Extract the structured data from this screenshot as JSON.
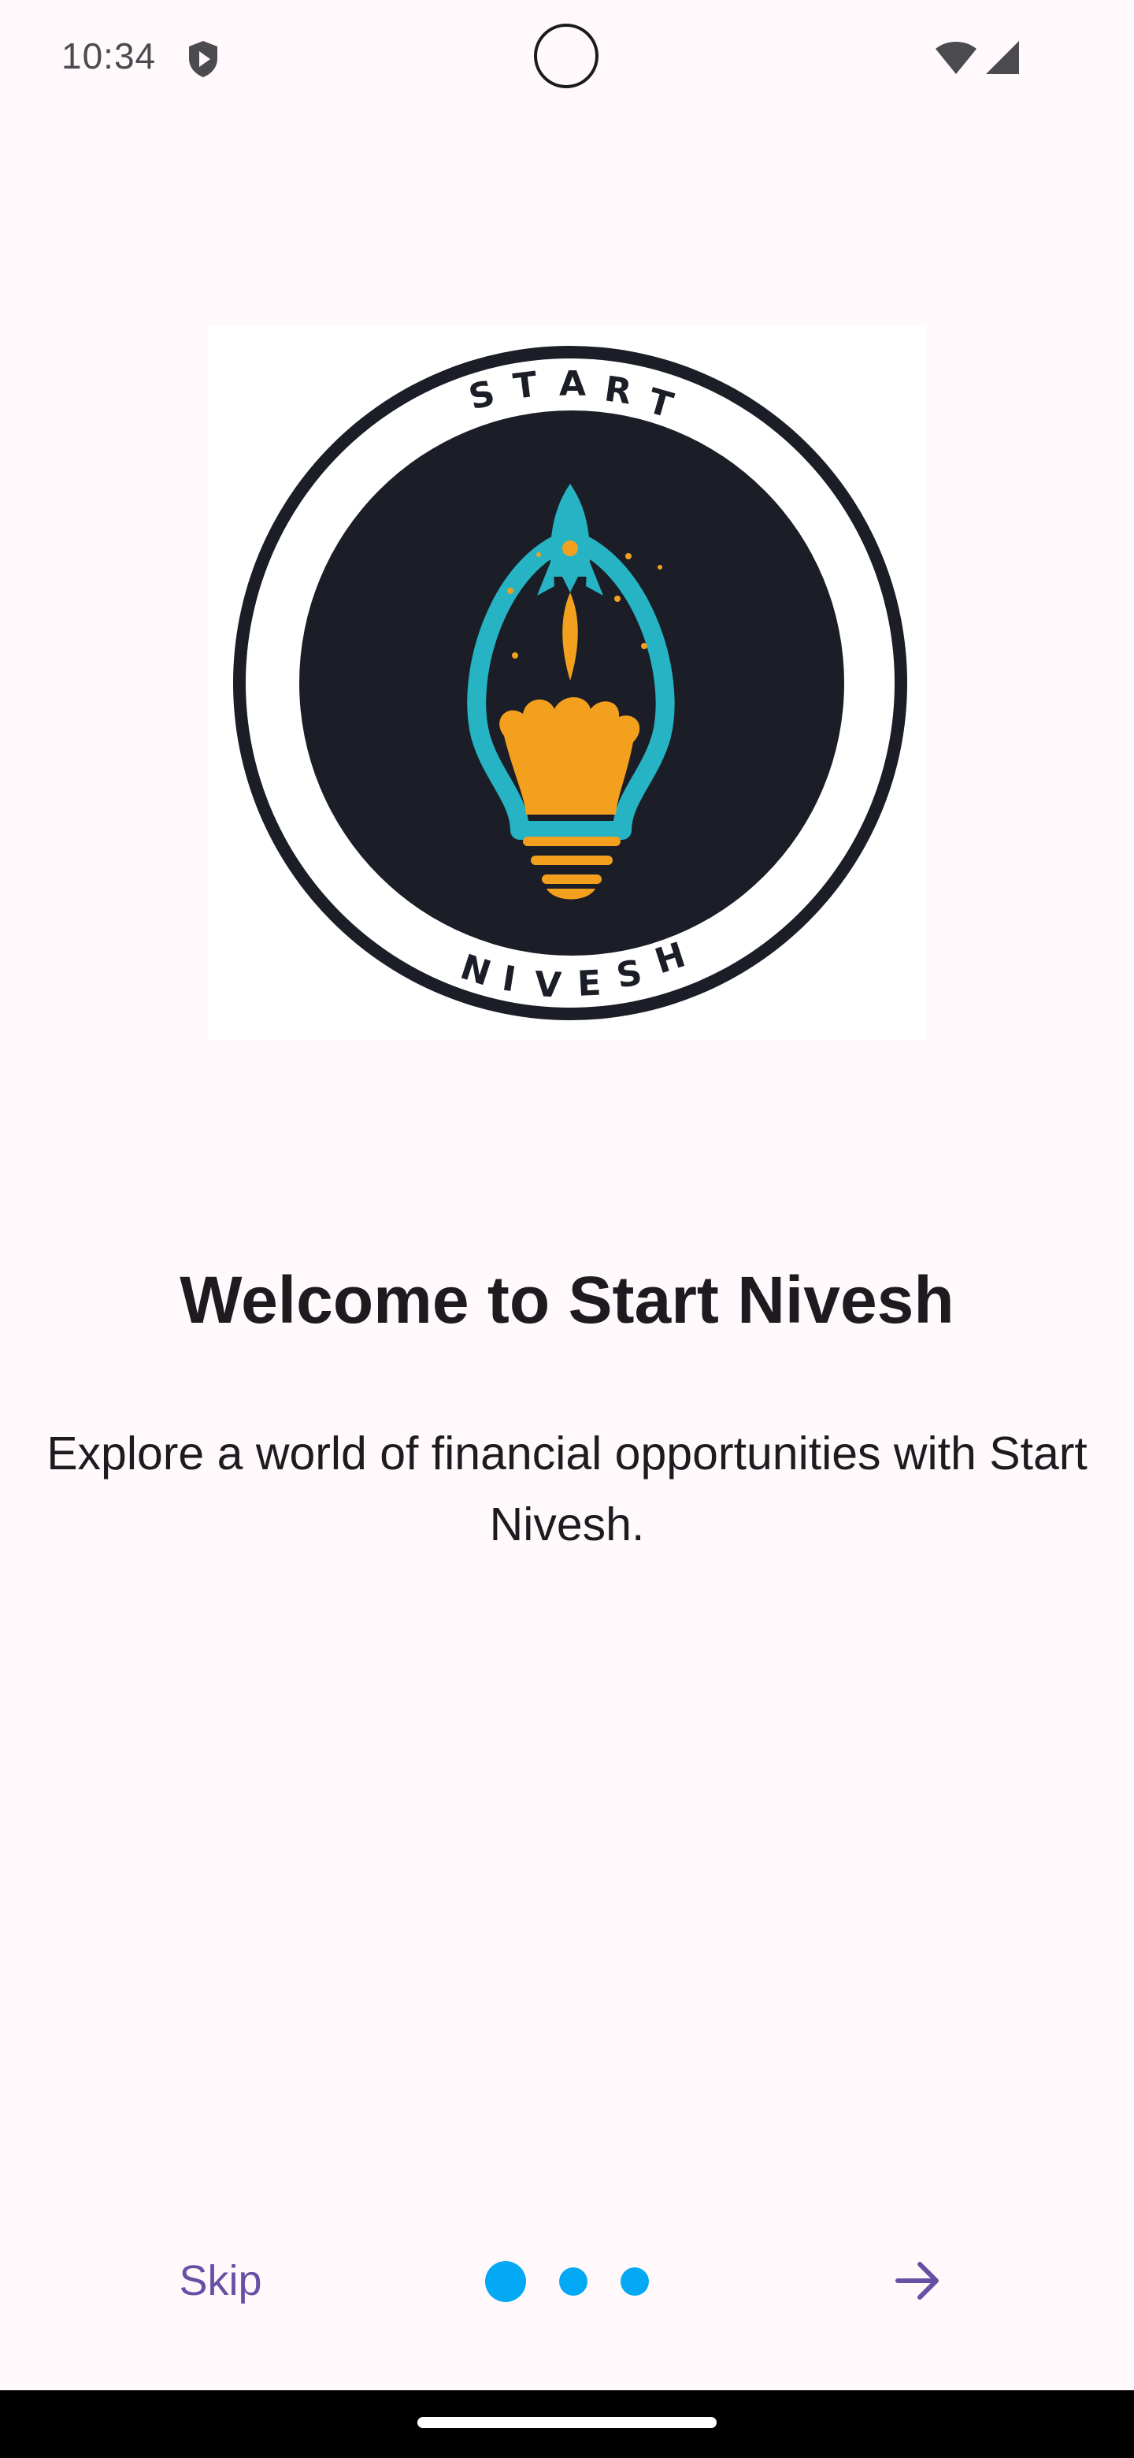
{
  "status_bar": {
    "time": "10:34",
    "icons": [
      "shield-icon",
      "wifi-icon",
      "signal-icon"
    ]
  },
  "logo": {
    "top_text": "START",
    "bottom_text": "NIVESH",
    "colors": {
      "ring": "#1b1d27",
      "bulb": "#26b3c3",
      "flame": "#f2a01e",
      "background": "#ffffff"
    }
  },
  "onboarding": {
    "title": "Welcome to Start Nivesh",
    "subtitle": "Explore a world of financial opportunities with Start Nivesh.",
    "current_page": 1,
    "total_pages": 3
  },
  "navigation": {
    "skip_label": "Skip",
    "next_icon": "arrow-right-icon"
  },
  "colors": {
    "accent": "#6750A4",
    "indicator": "#03A9F4",
    "background": "#FFF9FC",
    "text": "#1d1b20"
  }
}
